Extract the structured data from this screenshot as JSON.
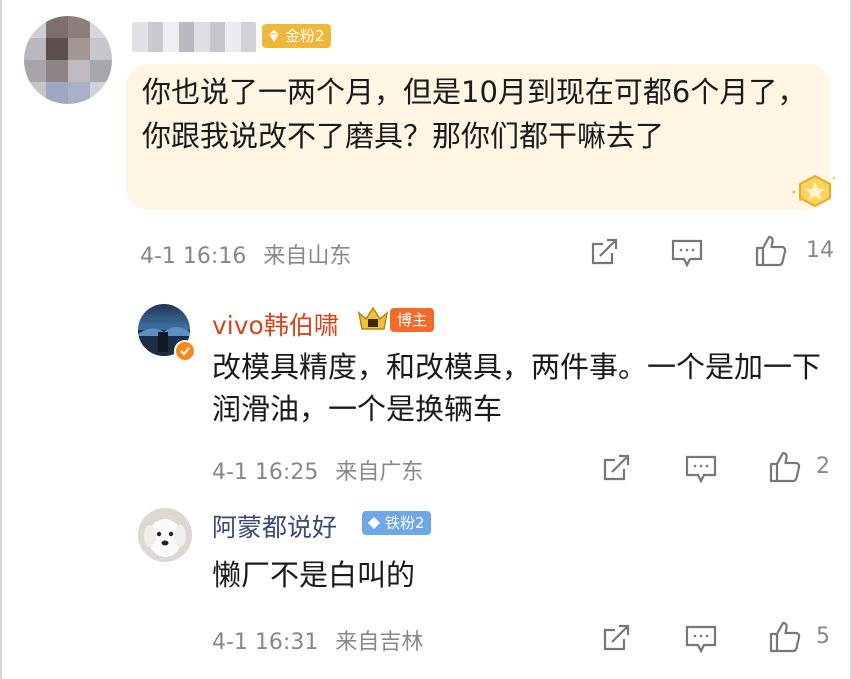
{
  "top_comment": {
    "username": "",
    "badge_label": "金粉2",
    "text": "你也说了一两个月，但是10月到现在可都6个月了，你跟我说改不了磨具？那你们都干嘛去了",
    "timestamp": "4-1 16:16",
    "location": "来自山东",
    "like_count": "14",
    "accent_color": "#f5a623"
  },
  "replies": [
    {
      "username": "vivo韩伯啸",
      "badge_label": "博主",
      "text": "改模具精度，和改模具，两件事。一个是加一下润滑油，一个是换辆车",
      "timestamp": "4-1 16:25",
      "location": "来自广东",
      "like_count": "2"
    },
    {
      "username": "阿蒙都说好",
      "badge_label": "铁粉2",
      "text": "懒厂不是白叫的",
      "timestamp": "4-1 16:31",
      "location": "来自吉林",
      "like_count": "5"
    }
  ],
  "icons": {
    "share": "share-icon",
    "comment": "comment-icon",
    "like": "thumbs-up-icon",
    "verified": "verified-icon",
    "crown": "crown-icon",
    "gold_fan": "gold-fan-icon",
    "iron_fan": "diamond-icon"
  }
}
